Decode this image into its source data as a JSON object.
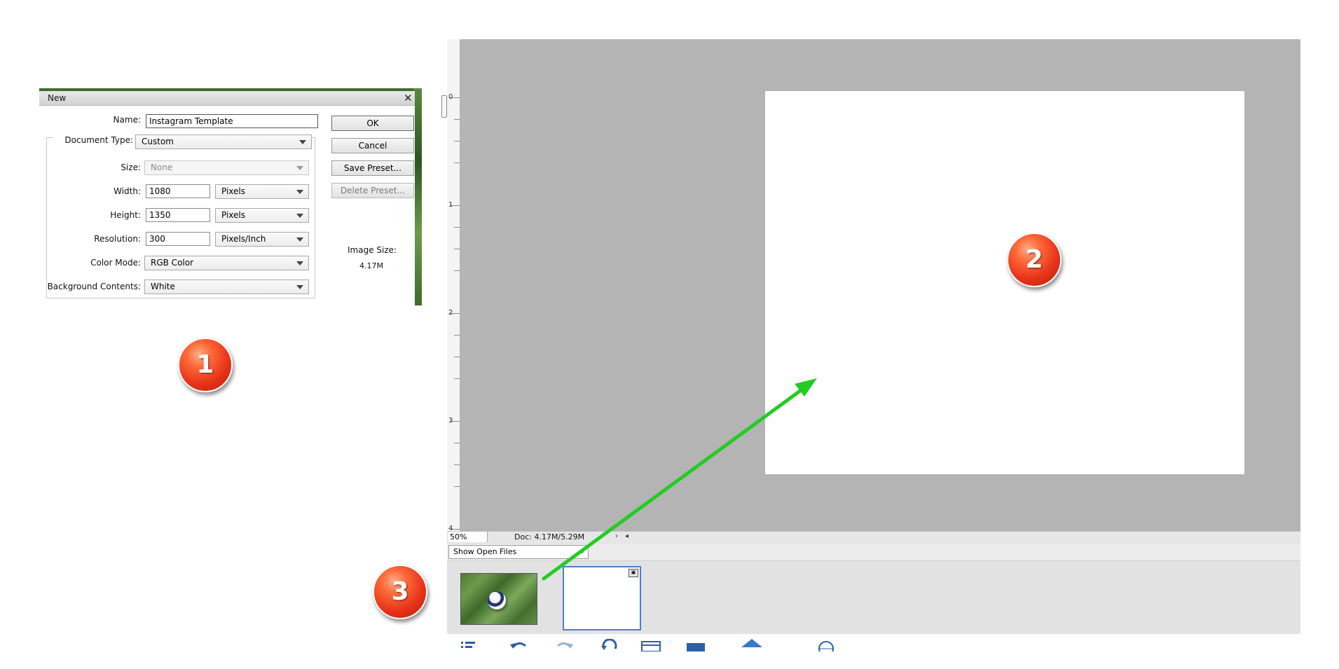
{
  "dialog": {
    "title": "New",
    "close_glyph": "✕",
    "name_label": "Name:",
    "name_value": "Instagram Template",
    "doc_type_label": "Document Type:",
    "doc_type_value": "Custom",
    "size_label": "Size:",
    "size_value": "None",
    "width_label": "Width:",
    "width_value": "1080",
    "width_unit": "Pixels",
    "height_label": "Height:",
    "height_value": "1350",
    "height_unit": "Pixels",
    "resolution_label": "Resolution:",
    "resolution_value": "300",
    "resolution_unit": "Pixels/Inch",
    "color_mode_label": "Color Mode:",
    "color_mode_value": "RGB Color",
    "bg_label": "Background Contents:",
    "bg_value": "White",
    "buttons": {
      "ok": "OK",
      "cancel": "Cancel",
      "save_preset": "Save Preset...",
      "delete_preset": "Delete Preset..."
    },
    "image_size_label": "Image Size:",
    "image_size_value": "4.17M"
  },
  "badges": [
    "1",
    "2",
    "3"
  ],
  "ruler": {
    "numbers": [
      "0",
      "1",
      "2",
      "3",
      "4"
    ]
  },
  "statusbar": {
    "zoom": "50%",
    "doc_info": "Doc: 4.17M/5.29M"
  },
  "photo_bin": {
    "show_select": "Show Open Files"
  },
  "colors": {
    "arrow": "#22cc22",
    "canvas_bg": "#b4b4b4",
    "badge": "#e8341a",
    "selected_thumb": "#4a7fd0"
  },
  "icons": [
    "undo-icon",
    "redo-icon",
    "rotate-icon",
    "layout-icon",
    "organizer-icon",
    "home-icon"
  ]
}
